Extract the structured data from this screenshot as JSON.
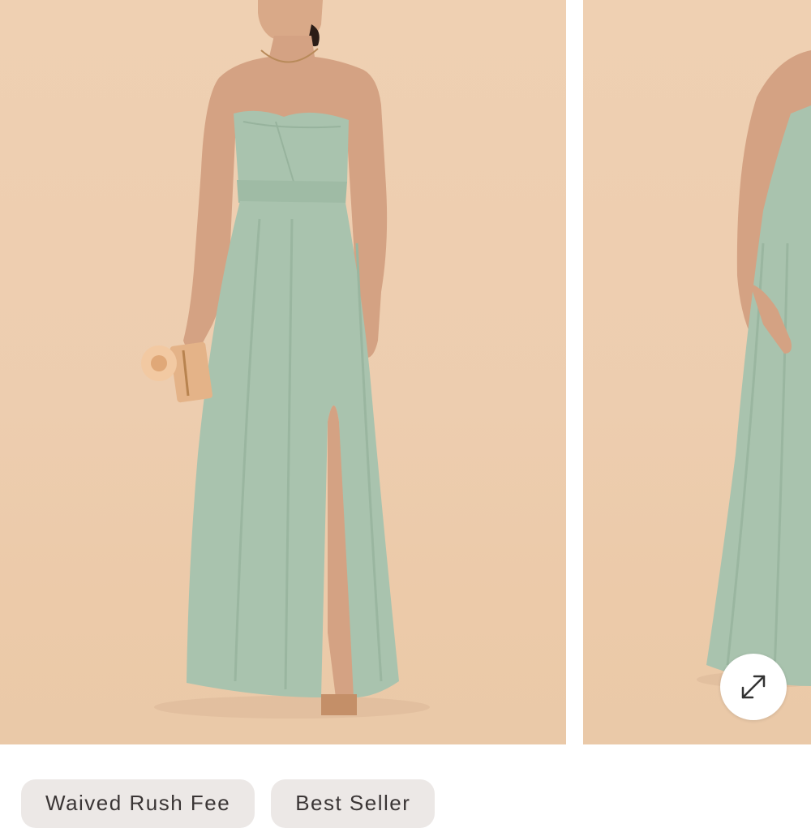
{
  "gallery": {
    "images": [
      {
        "subject": "model-front-sage-strapless-gown"
      },
      {
        "subject": "model-side-sage-gown"
      }
    ],
    "expand_icon": "expand-arrows-icon"
  },
  "badges": [
    {
      "label": "Waived Rush Fee"
    },
    {
      "label": "Best Seller"
    }
  ],
  "colors": {
    "backdrop": "#edcdaf",
    "dress": "#a9c3ae",
    "badge_bg": "#ece8e6",
    "badge_text": "#3a3535"
  }
}
